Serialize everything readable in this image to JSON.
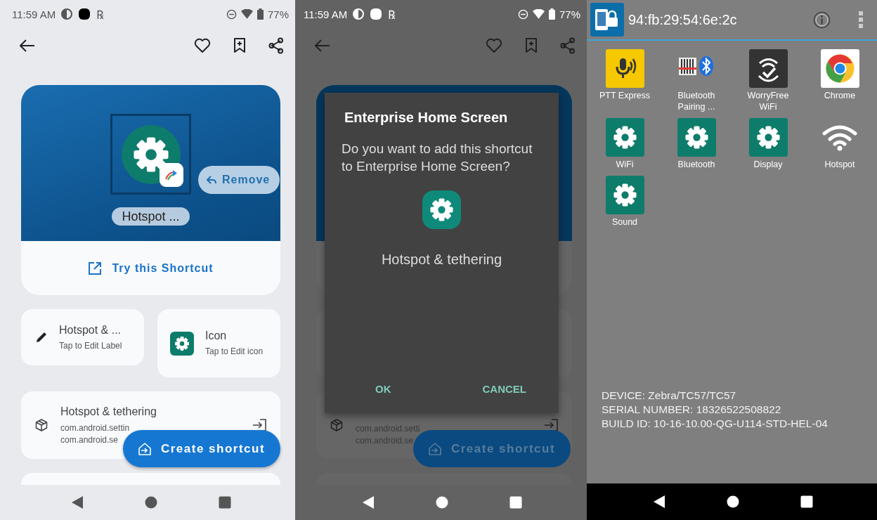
{
  "shortcut_editor": {
    "status_bar": {
      "time": "11:59 AM",
      "rx_symbol": "℞",
      "battery": "77%"
    },
    "hero": {
      "label": "Hotspot ...",
      "remove_button": "Remove"
    },
    "try_button": "Try this Shortcut",
    "options": [
      {
        "kind": "label",
        "title": "Hotspot & ...",
        "subtitle": "Tap to Edit Label"
      },
      {
        "kind": "icon",
        "title": "Icon",
        "subtitle": "Tap to Edit icon"
      }
    ],
    "app_card": {
      "title": "Hotspot & tethering",
      "lines": [
        "com.android.settin",
        "com.android.se"
      ]
    },
    "fab": "Create shortcut"
  },
  "dialog_screen": {
    "status_bar": {
      "time": "11:59 AM",
      "rx_symbol": "℞",
      "battery": "77%"
    },
    "background": {
      "app_lines": [
        "com.android.setti",
        "com.android.se"
      ],
      "fab": "Create shortcut"
    },
    "dialog": {
      "title": "Enterprise Home Screen",
      "message": "Do you want to add this shortcut to Enterprise Home Screen?",
      "app_name": "Hotspot & tethering",
      "buttons": [
        "OK",
        "CANCEL"
      ]
    }
  },
  "home_screen": {
    "header": {
      "title": "94:fb:29:54:6e:2c"
    },
    "apps": [
      {
        "kind": "ptt",
        "label": "PTT Express"
      },
      {
        "kind": "bluetooth_pairing",
        "label": "Bluetooth Pairing ..."
      },
      {
        "kind": "worryfree",
        "label": "WorryFree WiFi"
      },
      {
        "kind": "chrome",
        "label": "Chrome"
      },
      {
        "kind": "settings",
        "label": "WiFi"
      },
      {
        "kind": "settings",
        "label": "Bluetooth"
      },
      {
        "kind": "settings",
        "label": "Display"
      },
      {
        "kind": "hotspot",
        "label": "Hotspot"
      },
      {
        "kind": "settings",
        "label": "Sound"
      }
    ],
    "device_info": [
      "DEVICE: Zebra/TC57/TC57",
      "SERIAL NUMBER: 18326522508822",
      "BUILD ID: 10-16-10.00-QG-U114-STD-HEL-04"
    ]
  }
}
